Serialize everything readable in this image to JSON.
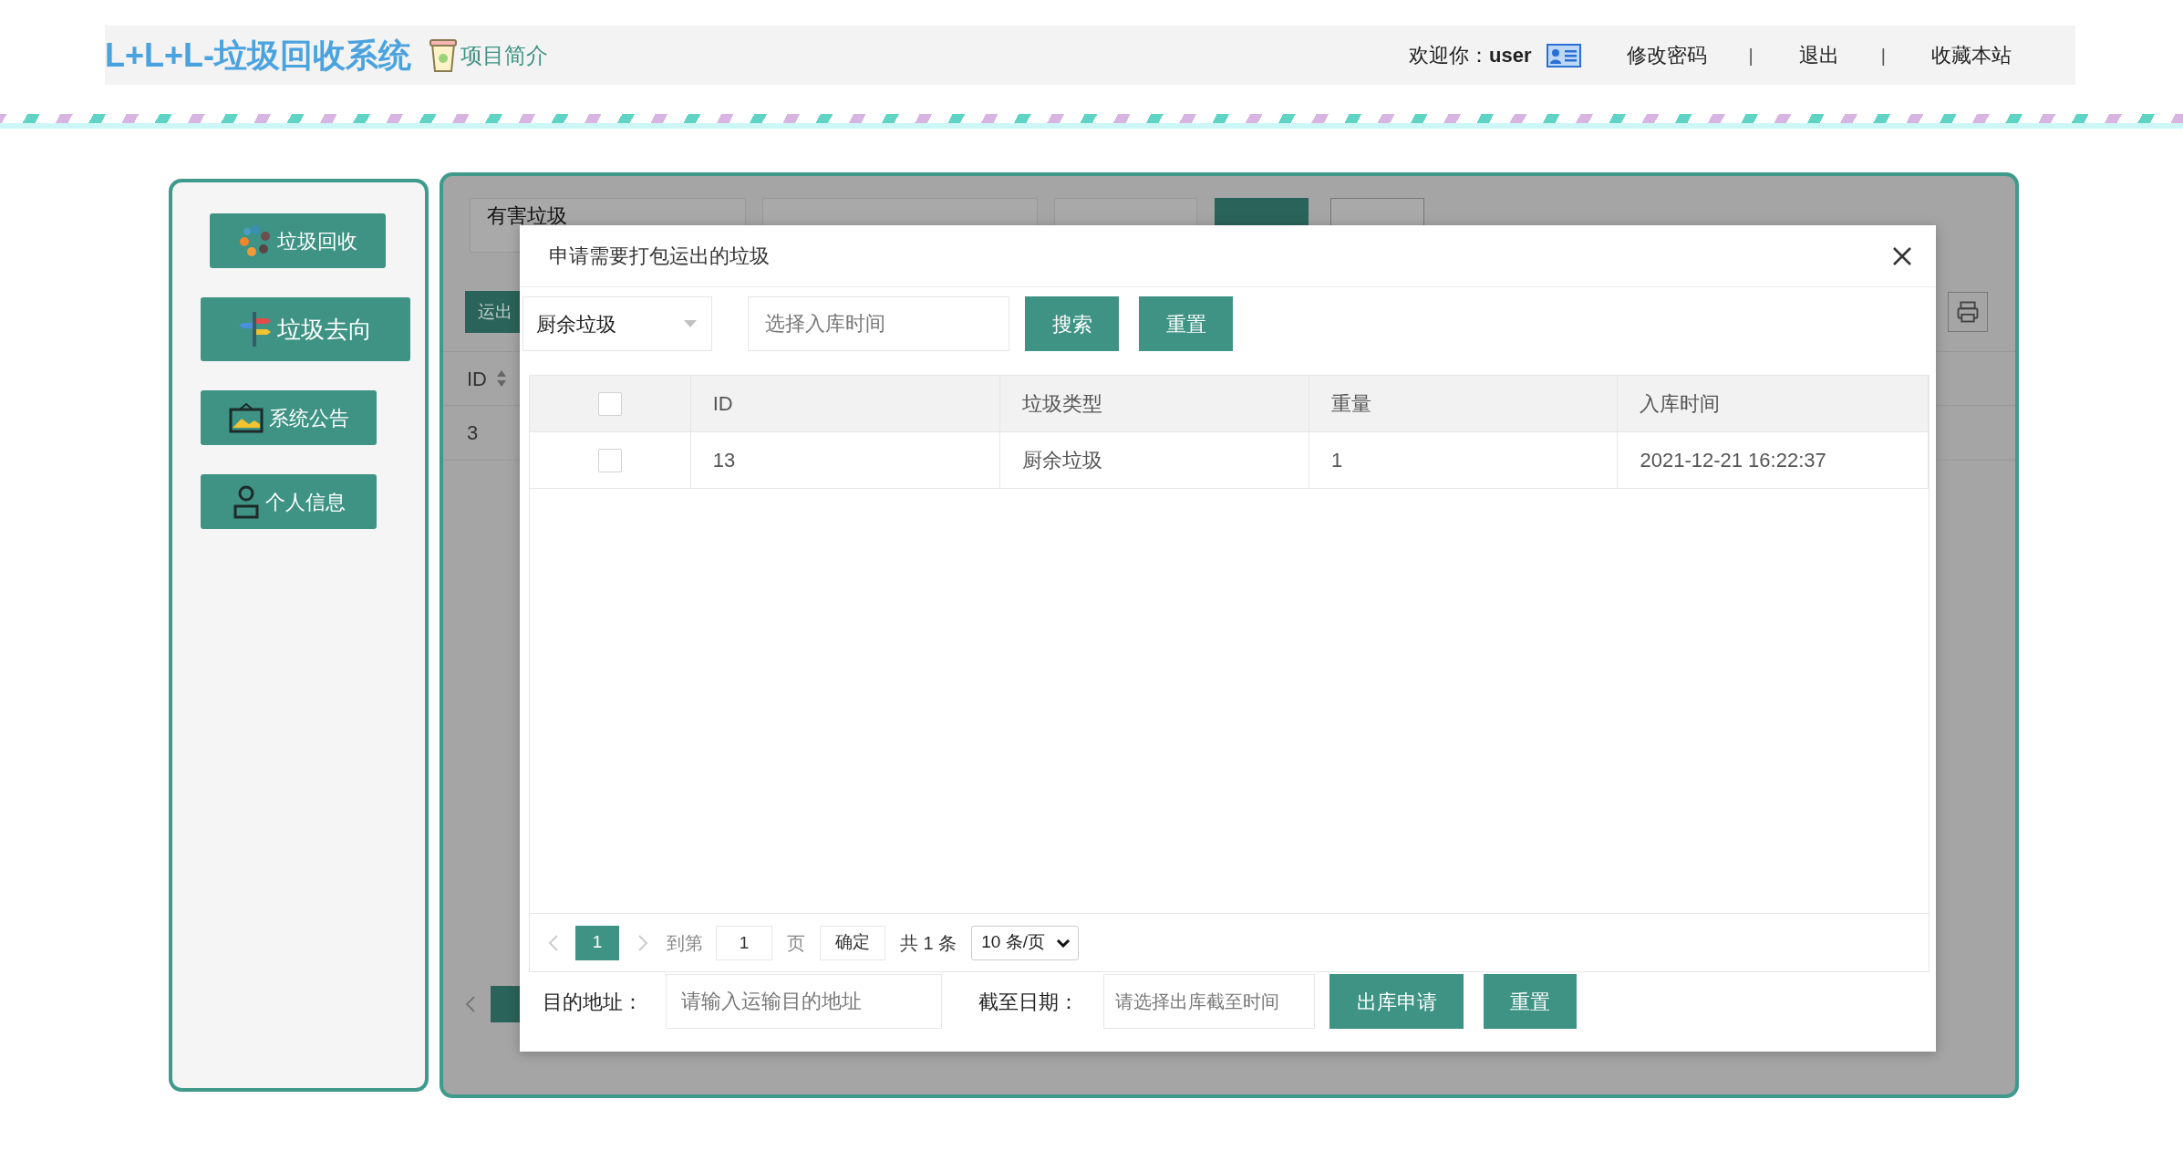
{
  "header": {
    "title": "L+L+L-垃圾回收系统",
    "intro_link": "项目简介",
    "welcome": "欢迎你：",
    "user": "user",
    "nav": [
      {
        "kind": "link",
        "text": "修改密码"
      },
      {
        "kind": "separator",
        "text": "|"
      },
      {
        "kind": "link",
        "text": "退出"
      },
      {
        "kind": "separator",
        "text": "|"
      },
      {
        "kind": "link",
        "text": "收藏本站"
      }
    ]
  },
  "sidebar": {
    "items": [
      {
        "label": "垃圾回收",
        "selected": false
      },
      {
        "label": "垃圾去向",
        "selected": true
      },
      {
        "label": "系统公告",
        "selected": false
      },
      {
        "label": "个人信息",
        "selected": false
      }
    ]
  },
  "background_panel": {
    "filter_value": "有害垃圾",
    "toolbar_button": "运出",
    "column": "ID",
    "cell": "3"
  },
  "dialog": {
    "title": "申请需要打包运出的垃圾",
    "filters": {
      "type_select": "厨余垃圾",
      "date_placeholder": "选择入库时间",
      "search": "搜索",
      "reset": "重置"
    },
    "table": {
      "header_checked": false,
      "columns": [
        "ID",
        "垃圾类型",
        "重量",
        "入库时间"
      ],
      "rows": [
        {
          "checked": false,
          "cells": [
            "13",
            "厨余垃圾",
            "1",
            "2021-12-21 16:22:37"
          ]
        }
      ]
    },
    "pagination": {
      "pages": [
        {
          "label": "1",
          "selected": true
        }
      ],
      "goto_label": "到第",
      "goto_value": "1",
      "page_unit": "页",
      "confirm": "确定",
      "total": "共 1 条",
      "page_size": "10 条/页"
    },
    "form": {
      "address_label": "目的地址：",
      "address_placeholder": "请输入运输目的地址",
      "date_label": "截至日期：",
      "date_placeholder": "请选择出库截至时间",
      "submit": "出库申请",
      "reset": "重置"
    }
  }
}
